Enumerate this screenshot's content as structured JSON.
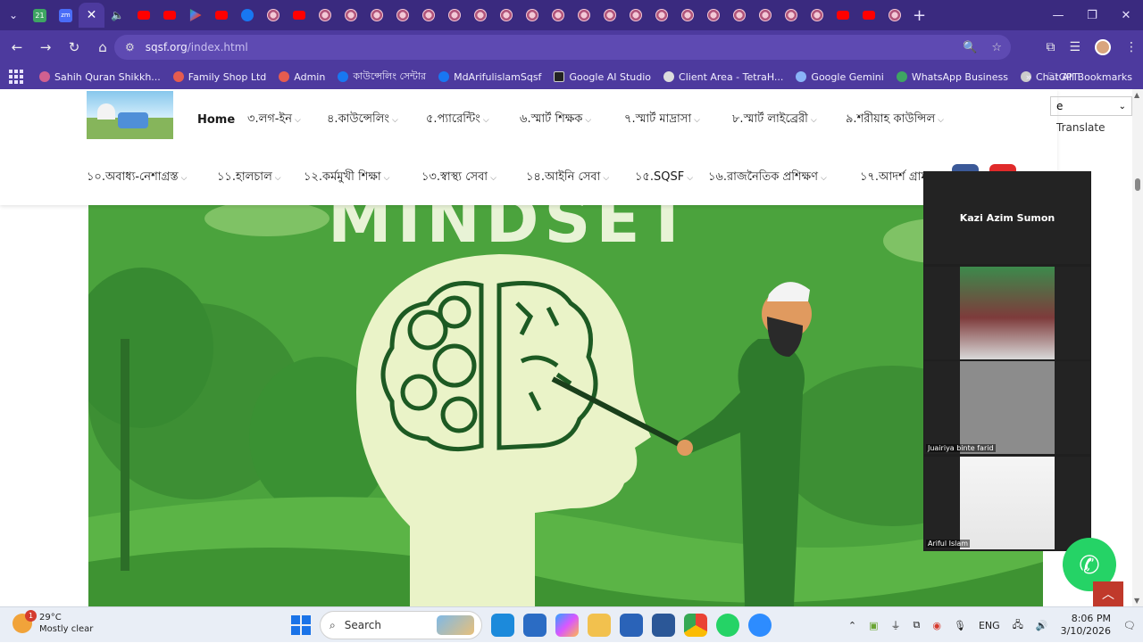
{
  "browser": {
    "new_tab_symbol": "+",
    "close_tab_symbol": "✕",
    "url_host": "sqsf.org",
    "url_path": "/index.html",
    "bookmarks": [
      {
        "label": "Sahih Quran Shikkh...",
        "color": "#d06090"
      },
      {
        "label": "Family Shop Ltd",
        "color": "#e65c4f"
      },
      {
        "label": "Admin",
        "color": "#e65c4f"
      },
      {
        "label": "কাউন্সেলিং সেন্টার",
        "color": "#1877f2"
      },
      {
        "label": "MdArifulislamSqsf",
        "color": "#1877f2"
      },
      {
        "label": "Google AI Studio",
        "color": "#222222"
      },
      {
        "label": "Client Area - TetraH...",
        "color": "#dddddd"
      },
      {
        "label": "Google Gemini",
        "color": "#8ab4f8"
      },
      {
        "label": "WhatsApp Business",
        "color": "#3ea563"
      },
      {
        "label": "ChatGPT",
        "color": "#cccccc"
      }
    ],
    "all_bookmarks": "All Bookmarks",
    "tab_badges": {
      "first": "21",
      "second": "zm"
    }
  },
  "site": {
    "menu_row1": [
      "Home",
      "৩.লগ-ইন",
      "৪.কাউন্সেলিং",
      "৫.প্যারেন্টিং",
      "৬.স্মার্ট শিক্ষক",
      "৭.স্মার্ট মাদ্রাসা",
      "৮.স্মার্ট লাইব্রেরী",
      "৯.শরীয়াহ কাউন্সিল"
    ],
    "menu_row2": [
      "১০.অবাধ্য-নেশাগ্রস্ত",
      "১১.হালচাল",
      "১২.কর্মমুখী শিক্ষা",
      "১৩.স্বাস্থ্য সেবা",
      "১৪.আইনি সেবা",
      "১৫.SQSF",
      "১৬.রাজনৈতিক প্রশিক্ষণ",
      "১৭.আদর্শ গ্রাম"
    ],
    "translate_label": "Translate",
    "lang_value": "e",
    "hero_title": "MINDSET"
  },
  "call": {
    "main_name": "Kazi Azim Sumon",
    "tile2_name": "",
    "tile3_name": "Juairiya binte farid",
    "tile4_name": "Ariful Islam"
  },
  "taskbar": {
    "weather_temp": "29°C",
    "weather_desc": "Mostly clear",
    "weather_badge": "1",
    "search_label": "Search",
    "lang": "ENG",
    "time": "8:06 PM",
    "date": "3/10/2026"
  }
}
